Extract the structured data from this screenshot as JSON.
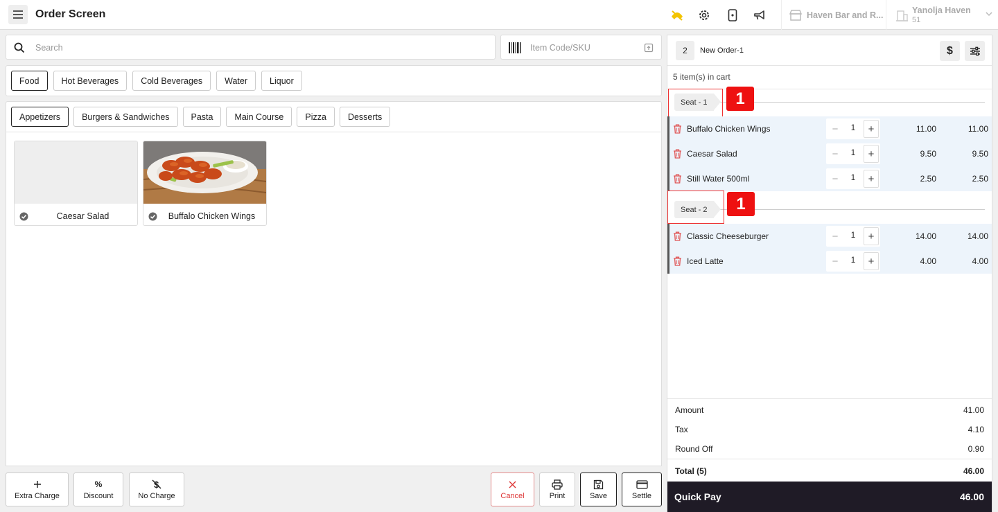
{
  "header": {
    "title": "Order Screen",
    "venue": "Haven Bar and R...",
    "user_name": "Yanolja Haven",
    "user_id": "51",
    "icons": [
      "menu-icon",
      "no-internet-icon",
      "settings-icon",
      "tablet-icon",
      "megaphone-icon"
    ]
  },
  "search": {
    "placeholder": "Search"
  },
  "sku": {
    "placeholder": "Item Code/SKU"
  },
  "categories": [
    "Food",
    "Hot Beverages",
    "Cold Beverages",
    "Water",
    "Liquor"
  ],
  "active_category": "Food",
  "subcategories": [
    "Appetizers",
    "Burgers & Sandwiches",
    "Pasta",
    "Main Course",
    "Pizza",
    "Desserts"
  ],
  "active_subcategory": "Appetizers",
  "products": [
    {
      "name": "Caesar Salad",
      "has_image": false
    },
    {
      "name": "Buffalo Chicken Wings",
      "has_image": true
    }
  ],
  "actions": {
    "extra_charge": "Extra Charge",
    "discount": "Discount",
    "discount_symbol": "%",
    "no_charge": "No Charge",
    "cancel": "Cancel",
    "print": "Print",
    "save": "Save",
    "settle": "Settle"
  },
  "order": {
    "number": "2",
    "name": "New Order-1",
    "currency_symbol": "$",
    "cart_count": "5 item(s) in cart",
    "seats": [
      {
        "label": "Seat - 1",
        "badge": "1",
        "items": [
          {
            "name": "Buffalo Chicken Wings",
            "qty": "1",
            "price": "11.00",
            "total": "11.00"
          },
          {
            "name": "Caesar Salad",
            "qty": "1",
            "price": "9.50",
            "total": "9.50"
          },
          {
            "name": "Still Water 500ml",
            "qty": "1",
            "price": "2.50",
            "total": "2.50"
          }
        ]
      },
      {
        "label": "Seat - 2",
        "badge": "1",
        "items": [
          {
            "name": "Classic Cheeseburger",
            "qty": "1",
            "price": "14.00",
            "total": "14.00"
          },
          {
            "name": "Iced Latte",
            "qty": "1",
            "price": "4.00",
            "total": "4.00"
          }
        ]
      }
    ],
    "summary": {
      "amount_label": "Amount",
      "amount": "41.00",
      "tax_label": "Tax",
      "tax": "4.10",
      "roundoff_label": "Round Off",
      "roundoff": "0.90",
      "total_label": "Total (5)",
      "total": "46.00"
    },
    "quick_pay_label": "Quick Pay",
    "quick_pay_amount": "46.00"
  },
  "colors": {
    "accent_dark": "#1f1b26",
    "highlight_red": "#e11111",
    "row_bg": "#edf4fb"
  }
}
